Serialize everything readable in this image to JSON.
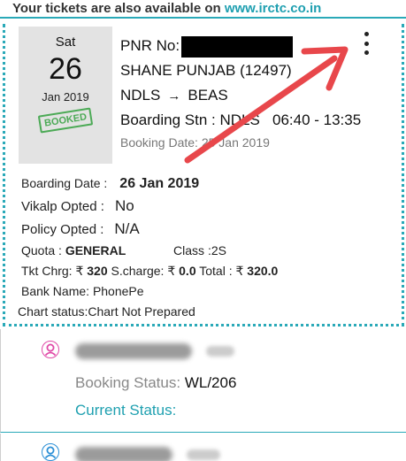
{
  "banner": {
    "text": "Your tickets are also available on ",
    "link": "www.irctc.co.in"
  },
  "ticket": {
    "date_day": "Sat",
    "date_num": "26",
    "date_month": "Jan 2019",
    "stamp": "BOOKED",
    "pnr_label": "PNR No:",
    "train": "SHANE PUNJAB (12497)",
    "from": "NDLS",
    "arrow": "→",
    "to": "BEAS",
    "boarding_stn": "Boarding Stn : NDLS",
    "time": "06:40 - 13:35",
    "booking_date_label": "Booking Date: 25 Jan 2019"
  },
  "details": {
    "boarding_date_label": "Boarding Date :",
    "boarding_date_value": "26 Jan 2019",
    "vikalp_label": "Vikalp Opted :",
    "vikalp_value": "No",
    "policy_label": "Policy Opted :",
    "policy_value": "N/A",
    "quota_label": "Quota :",
    "quota_value": "GENERAL",
    "class_label": "Class :",
    "class_value": "2S",
    "tkt_chrg_label": "Tkt Chrg: ₹",
    "tkt_chrg_value": "320",
    "scharge_label": "S.charge: ₹",
    "scharge_value": "0.0",
    "total_label": "Total : ₹",
    "total_value": "320.0",
    "bank_label": "Bank Name:",
    "bank_value": "PhonePe",
    "chart_label": "Chart status:",
    "chart_value": "Chart Not Prepared"
  },
  "passengers": [
    {
      "booking_status_label": "Booking Status:",
      "booking_status_value": "WL/206",
      "current_status_label": "Current Status:",
      "icon": "female-user-icon"
    },
    {
      "icon": "male-user-icon"
    }
  ],
  "colors": {
    "accent": "#2aa9b8",
    "stamp": "#4caa56",
    "annotation_arrow": "#e8474b"
  }
}
